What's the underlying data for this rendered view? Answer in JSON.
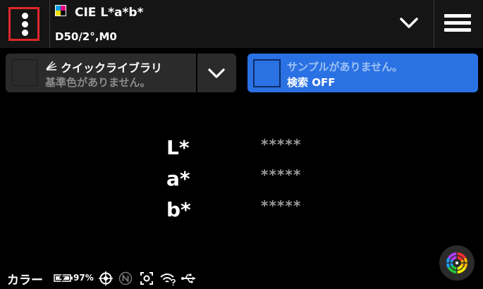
{
  "header": {
    "title": "CIE L*a*b*",
    "subtitle": "D50/2°,M0",
    "icons": [
      "more-vertical-icon",
      "cmyk-icon",
      "chevron-down-icon",
      "hamburger-menu-icon"
    ],
    "colors": {
      "highlight_border": "#e0262b",
      "cmyk": [
        "#00a0e6",
        "#e6007e",
        "#ffe100",
        "#000000"
      ]
    }
  },
  "library": {
    "title": "クイックライブラリ",
    "status": "基準色がありません。",
    "icons": [
      "library-fan-icon",
      "chevron-down-icon"
    ]
  },
  "sample": {
    "status": "サンプルがありません。",
    "search": "検索 OFF",
    "accent": "#2a72e4"
  },
  "measurement": {
    "rows": [
      {
        "label": "L*",
        "value": "*****"
      },
      {
        "label": "a*",
        "value": "*****"
      },
      {
        "label": "b*",
        "value": "*****"
      }
    ]
  },
  "status_bar": {
    "mode": "カラー",
    "battery_percent": "97%",
    "icons": [
      "battery-charging-icon",
      "target-icon",
      "n-badge-icon",
      "camera-frame-icon",
      "wifi-question-icon",
      "usb-icon",
      "color-wheel-icon"
    ]
  }
}
